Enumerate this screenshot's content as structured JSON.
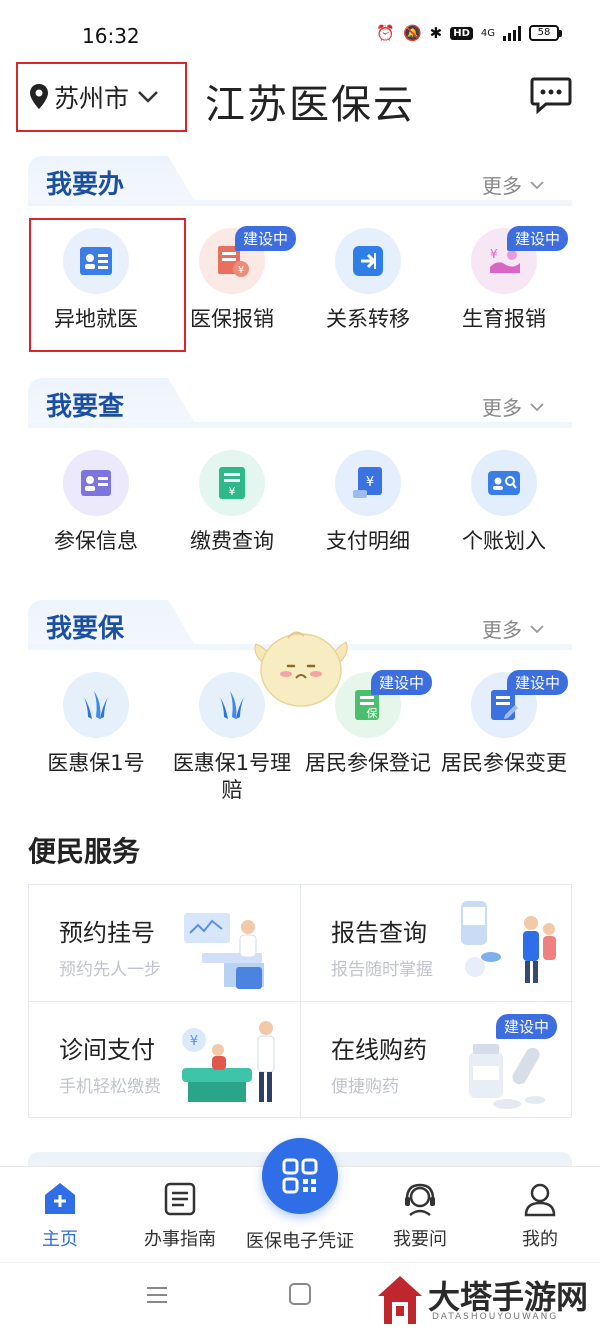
{
  "status_bar": {
    "time": "16:32",
    "network": "4G",
    "hd": "HD",
    "battery": "58"
  },
  "header": {
    "city": "苏州市",
    "title": "江苏医保云"
  },
  "sections": [
    {
      "title": "我要办",
      "more": "更多",
      "items": [
        {
          "label": "异地就医",
          "icon": "id-card-icon",
          "badge": ""
        },
        {
          "label": "医保报销",
          "icon": "receipt-yen-icon",
          "badge": "建设中"
        },
        {
          "label": "关系转移",
          "icon": "transfer-arrow-icon",
          "badge": ""
        },
        {
          "label": "生育报销",
          "icon": "maternity-icon",
          "badge": "建设中"
        }
      ]
    },
    {
      "title": "我要查",
      "more": "更多",
      "items": [
        {
          "label": "参保信息",
          "icon": "insurance-card-icon",
          "badge": ""
        },
        {
          "label": "缴费查询",
          "icon": "payment-doc-icon",
          "badge": ""
        },
        {
          "label": "支付明细",
          "icon": "payment-detail-icon",
          "badge": ""
        },
        {
          "label": "个账划入",
          "icon": "account-transfer-icon",
          "badge": ""
        }
      ]
    },
    {
      "title": "我要保",
      "more": "更多",
      "items": [
        {
          "label": "医惠保1号",
          "icon": "leaf-shield-icon",
          "badge": ""
        },
        {
          "label": "医惠保1号理赔",
          "icon": "leaf-shield-icon",
          "badge": ""
        },
        {
          "label": "居民参保登记",
          "icon": "register-doc-icon",
          "badge": "建设中"
        },
        {
          "label": "居民参保变更",
          "icon": "edit-doc-icon",
          "badge": "建设中"
        }
      ]
    }
  ],
  "convenience": {
    "title": "便民服务",
    "items": [
      {
        "title": "预约挂号",
        "subtitle": "预约先人一步",
        "badge": ""
      },
      {
        "title": "报告查询",
        "subtitle": "报告随时掌握",
        "badge": ""
      },
      {
        "title": "诊间支付",
        "subtitle": "手机轻松缴费",
        "badge": ""
      },
      {
        "title": "在线购药",
        "subtitle": "便捷购药",
        "badge": "建设中"
      }
    ]
  },
  "tabbar": {
    "items": [
      {
        "label": "主页",
        "icon": "home-plus-icon",
        "active": true
      },
      {
        "label": "办事指南",
        "icon": "guide-list-icon",
        "active": false
      },
      {
        "label": "医保电子凭证",
        "icon": "qr-code-icon",
        "active": false
      },
      {
        "label": "我要问",
        "icon": "headset-icon",
        "active": false
      },
      {
        "label": "我的",
        "icon": "user-icon",
        "active": false
      }
    ]
  },
  "watermark": {
    "text": "大塔手游网",
    "sub": "DATASHOUYOUWANG"
  },
  "colors": {
    "primary": "#2f6ee6",
    "section_title": "#1b4fa0",
    "highlight": "#d9252b",
    "badge": "#3d6ee0"
  }
}
